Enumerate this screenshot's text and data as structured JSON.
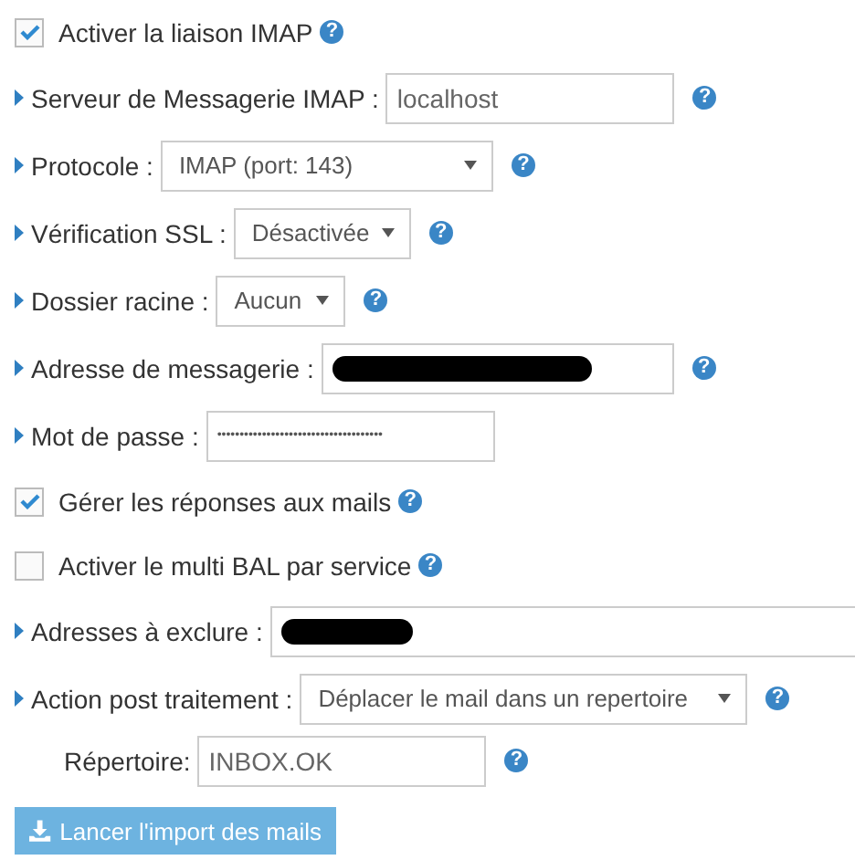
{
  "help_glyph": "?",
  "rows": [
    {
      "kind": "checkbox",
      "label": "Activer la liaison IMAP",
      "checked": true,
      "help": true
    },
    {
      "kind": "text",
      "label": "Serveur de Messagerie IMAP :",
      "value": "localhost",
      "help": true
    },
    {
      "kind": "select",
      "label": "Protocole :",
      "value": "IMAP (port: 143)",
      "help": true
    },
    {
      "kind": "select",
      "label": "Vérification SSL :",
      "value": "Désactivée",
      "help": true
    },
    {
      "kind": "select",
      "label": "Dossier racine :",
      "value": "Aucun",
      "help": true
    },
    {
      "kind": "text",
      "label": "Adresse de messagerie :",
      "redacted": true,
      "help": true
    },
    {
      "kind": "password",
      "label": "Mot de passe :",
      "value": "•••••••••••••••••••••••••••••••••••••",
      "help": false
    },
    {
      "kind": "checkbox",
      "label": "Gérer les réponses aux mails",
      "checked": true,
      "help": true
    },
    {
      "kind": "checkbox",
      "label": "Activer le multi BAL par service",
      "checked": false,
      "help": true
    },
    {
      "kind": "text",
      "label": "Adresses à exclure :",
      "redacted": true,
      "help": false
    },
    {
      "kind": "select",
      "label": "Action post traitement :",
      "value": "Déplacer le mail dans un repertoire",
      "help": true
    },
    {
      "kind": "subtext",
      "label": "Répertoire:",
      "value": "INBOX.OK",
      "help": true
    }
  ],
  "button": {
    "label": "Lancer l'import des mails"
  }
}
